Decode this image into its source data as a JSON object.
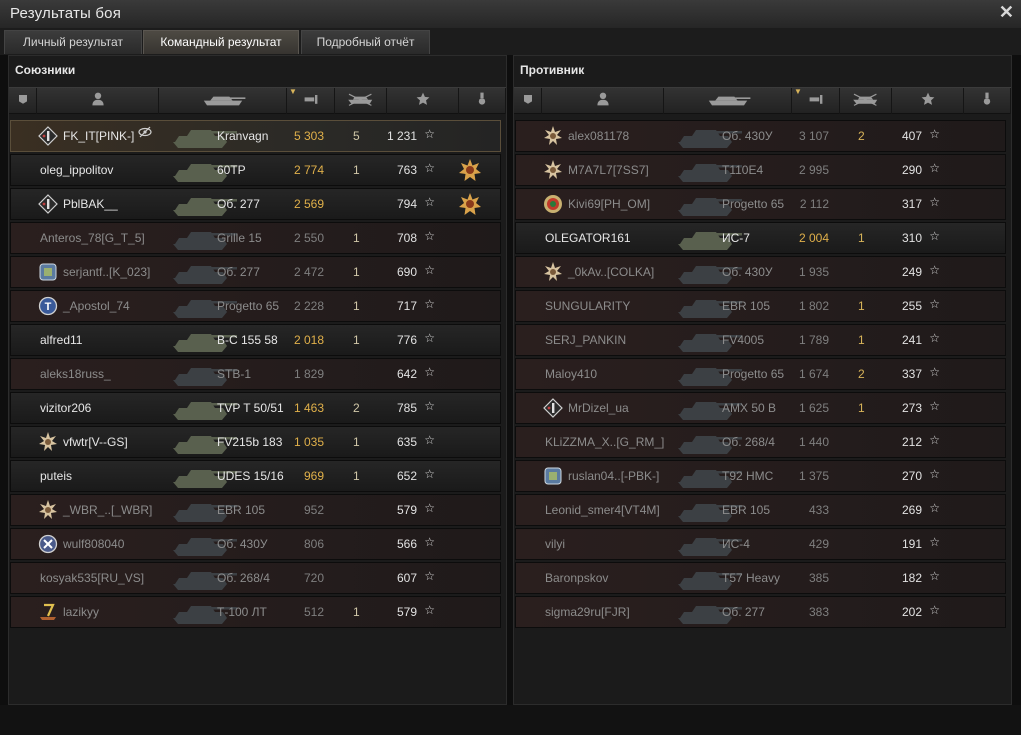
{
  "window": {
    "title": "Результаты боя",
    "close_glyph": "✕"
  },
  "tabs": [
    {
      "label": "Личный результат",
      "active": false
    },
    {
      "label": "Командный результат",
      "active": true
    },
    {
      "label": "Подробный отчёт",
      "active": false
    }
  ],
  "allies": {
    "title": "Союзники",
    "rows": [
      {
        "player": "FK_IT[PINK-]",
        "badge": "diamond-badge-icon",
        "tank": "Kranvagn",
        "damage": "5 303",
        "kills": "5",
        "xp": "1 231",
        "alive": true,
        "medal": null,
        "highlight": true,
        "tag_icon": "hidden-eye-icon"
      },
      {
        "player": "oleg_ippolitov",
        "badge": null,
        "tank": "60TP",
        "damage": "2 774",
        "kills": "1",
        "xp": "763",
        "alive": true,
        "medal": "order-medal-icon"
      },
      {
        "player": "PblBAK__",
        "badge": "diamond-badge-icon",
        "tank": "Об. 277",
        "damage": "2 569",
        "kills": "",
        "xp": "794",
        "alive": true,
        "medal": "order-medal-icon"
      },
      {
        "player": "Anteros_78[G_T_5]",
        "badge": null,
        "tank": "Grille 15",
        "damage": "2 550",
        "kills": "1",
        "xp": "708",
        "alive": false,
        "medal": null
      },
      {
        "player": "serjantf..[K_023]",
        "badge": "cube-badge-icon",
        "tank": "Об. 277",
        "damage": "2 472",
        "kills": "1",
        "xp": "690",
        "alive": false,
        "medal": null
      },
      {
        "player": "_Apostol_74",
        "badge": "t-circle-badge-icon",
        "tank": "Progetto 65",
        "damage": "2 228",
        "kills": "1",
        "xp": "717",
        "alive": false,
        "medal": null
      },
      {
        "player": "alfred11",
        "badge": null,
        "tank": "B-C 155 58",
        "damage": "2 018",
        "kills": "1",
        "xp": "776",
        "alive": true,
        "medal": null
      },
      {
        "player": "aleks18russ_",
        "badge": null,
        "tank": "STB-1",
        "damage": "1 829",
        "kills": "",
        "xp": "642",
        "alive": false,
        "medal": null
      },
      {
        "player": "vizitor206",
        "badge": null,
        "tank": "TVP T 50/51",
        "damage": "1 463",
        "kills": "2",
        "xp": "785",
        "alive": true,
        "medal": null
      },
      {
        "player": "vfwtr[V--GS]",
        "badge": "star-burst-badge-icon",
        "tank": "FV215b 183",
        "damage": "1 035",
        "kills": "1",
        "xp": "635",
        "alive": true,
        "medal": null
      },
      {
        "player": "puteis",
        "badge": null,
        "tank": "UDES 15/16",
        "damage": "969",
        "kills": "1",
        "xp": "652",
        "alive": true,
        "medal": null
      },
      {
        "player": "_WBR_..[_WBR]",
        "badge": "star-burst-badge-icon",
        "tank": "EBR 105",
        "damage": "952",
        "kills": "",
        "xp": "579",
        "alive": false,
        "medal": null
      },
      {
        "player": "wulf808040",
        "badge": "x-circle-badge-icon",
        "tank": "Об. 430У",
        "damage": "806",
        "kills": "",
        "xp": "566",
        "alive": false,
        "medal": null
      },
      {
        "player": "kosyak535[RU_VS]",
        "badge": null,
        "tank": "Об. 268/4",
        "damage": "720",
        "kills": "",
        "xp": "607",
        "alive": false,
        "medal": null
      },
      {
        "player": "lazikyy",
        "badge": "seven-badge-icon",
        "tank": "Т-100 ЛТ",
        "damage": "512",
        "kills": "1",
        "xp": "579",
        "alive": false,
        "medal": null
      }
    ]
  },
  "enemies": {
    "title": "Противник",
    "rows": [
      {
        "player": "alex081178",
        "badge": "star-burst-badge-icon",
        "tank": "Об. 430У",
        "damage": "3 107",
        "kills": "2",
        "xp": "407",
        "alive": false
      },
      {
        "player": "M7A7L7[7SS7]",
        "badge": "star-burst-badge-icon",
        "tank": "T110E4",
        "damage": "2 995",
        "kills": "",
        "xp": "290",
        "alive": false
      },
      {
        "player": "Kivi69[PH_OM]",
        "badge": "emblem-badge-icon",
        "tank": "Progetto 65",
        "damage": "2 112",
        "kills": "",
        "xp": "317",
        "alive": false
      },
      {
        "player": "OLEGATOR161",
        "badge": null,
        "tank": "ИС-7",
        "damage": "2 004",
        "kills": "1",
        "xp": "310",
        "alive": true
      },
      {
        "player": "_0kAv..[COLKA]",
        "badge": "star-burst-badge-icon",
        "tank": "Об. 430У",
        "damage": "1 935",
        "kills": "",
        "xp": "249",
        "alive": false
      },
      {
        "player": "SUNGULARITY",
        "badge": null,
        "tank": "EBR 105",
        "damage": "1 802",
        "kills": "1",
        "xp": "255",
        "alive": false
      },
      {
        "player": "SERJ_PANKIN",
        "badge": null,
        "tank": "FV4005",
        "damage": "1 789",
        "kills": "1",
        "xp": "241",
        "alive": false
      },
      {
        "player": "Maloy410",
        "badge": null,
        "tank": "Progetto 65",
        "damage": "1 674",
        "kills": "2",
        "xp": "337",
        "alive": false
      },
      {
        "player": "MrDizel_ua",
        "badge": "diamond-badge-icon",
        "tank": "AMX 50 B",
        "damage": "1 625",
        "kills": "1",
        "xp": "273",
        "alive": false
      },
      {
        "player": "KLiZZMA_X..[G_RM_]",
        "badge": null,
        "tank": "Об. 268/4",
        "damage": "1 440",
        "kills": "",
        "xp": "212",
        "alive": false
      },
      {
        "player": "ruslan04..[-PBK-]",
        "badge": "cube-badge-icon",
        "tank": "T92 HMC",
        "damage": "1 375",
        "kills": "",
        "xp": "270",
        "alive": false
      },
      {
        "player": "Leonid_smer4[VT4M]",
        "badge": null,
        "tank": "EBR 105",
        "damage": "433",
        "kills": "",
        "xp": "269",
        "alive": false
      },
      {
        "player": "vilyi",
        "badge": null,
        "tank": "ИС-4",
        "damage": "429",
        "kills": "",
        "xp": "191",
        "alive": false
      },
      {
        "player": "Baronpskov",
        "badge": null,
        "tank": "T57 Heavy",
        "damage": "385",
        "kills": "",
        "xp": "182",
        "alive": false
      },
      {
        "player": "sigma29ru[FJR]",
        "badge": null,
        "tank": "Об. 277",
        "damage": "383",
        "kills": "",
        "xp": "202",
        "alive": false
      }
    ]
  },
  "column_icons": [
    "platoon-icon",
    "player-icon",
    "tank-icon",
    "damage-icon",
    "kills-icon",
    "xp-star-icon",
    "medal-icon"
  ],
  "colors": {
    "accent_gold": "#e0b04a",
    "alive_text": "#e6e6e6",
    "dead_text": "#8c8c8c",
    "dead_row_tint": "#2a1f1e"
  }
}
